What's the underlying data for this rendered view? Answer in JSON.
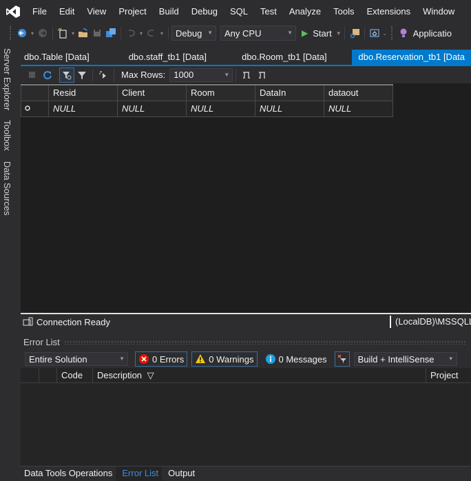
{
  "menubar": {
    "logo": "visual-studio-logo",
    "items": [
      "File",
      "Edit",
      "View",
      "Project",
      "Build",
      "Debug",
      "SQL",
      "Test",
      "Analyze",
      "Tools",
      "Extensions",
      "Window"
    ]
  },
  "toolbar": {
    "configuration": "Debug",
    "platform": "Any CPU",
    "start_label": "Start",
    "application_label": "Applicatio"
  },
  "sidebar": {
    "tabs": [
      "Server Explorer",
      "Toolbox",
      "Data Sources"
    ]
  },
  "doc_tabs": [
    {
      "label": "dbo.Table [Data]",
      "active": false
    },
    {
      "label": "dbo.staff_tb1 [Data]",
      "active": false
    },
    {
      "label": "dbo.Room_tb1 [Data]",
      "active": false
    },
    {
      "label": "dbo.Reservation_tb1 [Data",
      "active": true
    }
  ],
  "grid_toolbar": {
    "max_rows_label": "Max Rows:",
    "max_rows_value": "1000"
  },
  "grid": {
    "columns": [
      "Resid",
      "Client",
      "Room",
      "DataIn",
      "dataout"
    ],
    "rows": [
      [
        "NULL",
        "NULL",
        "NULL",
        "NULL",
        "NULL"
      ]
    ],
    "new_row_marker": "⭘"
  },
  "status": {
    "connection": "Connection Ready",
    "server": "(LocalDB)\\MSSQLLocalDB"
  },
  "error_list": {
    "title": "Error List",
    "scope": "Entire Solution",
    "errors": "0 Errors",
    "warnings": "0 Warnings",
    "messages": "0 Messages",
    "build_filter": "Build + IntelliSense",
    "columns": [
      "Code",
      "Description",
      "Project"
    ]
  },
  "bottom_tabs": [
    {
      "label": "Data Tools Operations",
      "active": false
    },
    {
      "label": "Error List",
      "active": true
    },
    {
      "label": "Output",
      "active": false
    }
  ],
  "colors": {
    "accent": "#007acc",
    "background": "#2d2d30",
    "editor": "#1e1e1e",
    "active_bottom_tab": "#3d8ee0"
  }
}
